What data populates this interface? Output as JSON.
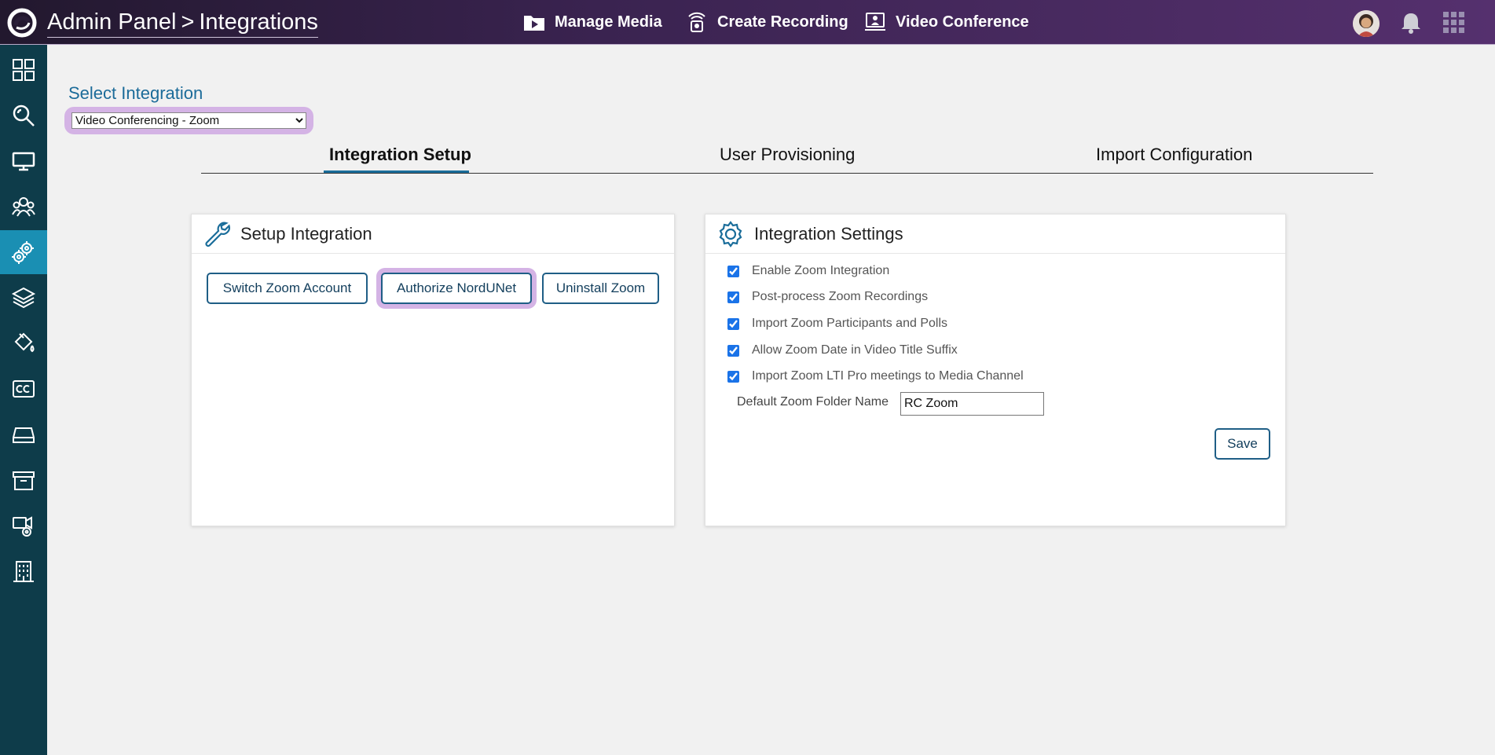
{
  "header": {
    "breadcrumb_root": "Admin Panel",
    "breadcrumb_sep": ">",
    "breadcrumb_current": "Integrations",
    "nav": [
      {
        "label": "Manage Media",
        "icon": "media-folder-icon"
      },
      {
        "label": "Create Recording",
        "icon": "recording-icon"
      },
      {
        "label": "Video Conference",
        "icon": "video-conference-icon"
      }
    ]
  },
  "sidebar": {
    "items": [
      {
        "icon": "dashboard-icon"
      },
      {
        "icon": "search-icon"
      },
      {
        "icon": "monitor-icon"
      },
      {
        "icon": "users-icon"
      },
      {
        "icon": "settings-gears-icon",
        "active": true
      },
      {
        "icon": "layers-icon"
      },
      {
        "icon": "paint-bucket-icon"
      },
      {
        "icon": "closed-caption-icon"
      },
      {
        "icon": "drive-icon"
      },
      {
        "icon": "archive-icon"
      },
      {
        "icon": "video-settings-icon"
      },
      {
        "icon": "building-icon"
      }
    ]
  },
  "select_integration": {
    "label": "Select Integration",
    "selected": "Video Conferencing - Zoom"
  },
  "tabs": [
    {
      "label": "Integration Setup",
      "active": true
    },
    {
      "label": "User Provisioning"
    },
    {
      "label": "Import Configuration"
    }
  ],
  "setup_card": {
    "title": "Setup Integration",
    "buttons": {
      "switch": "Switch Zoom Account",
      "authorize": "Authorize NordUNet",
      "uninstall": "Uninstall Zoom"
    }
  },
  "settings_card": {
    "title": "Integration Settings",
    "options": [
      {
        "label": "Enable Zoom Integration",
        "checked": true
      },
      {
        "label": "Post-process Zoom Recordings",
        "checked": true
      },
      {
        "label": "Import Zoom Participants and Polls",
        "checked": true
      },
      {
        "label": "Allow Zoom Date in Video Title Suffix",
        "checked": true
      },
      {
        "label": "Import Zoom LTI Pro meetings to Media Channel",
        "checked": true
      }
    ],
    "folder_label": "Default Zoom Folder Name",
    "folder_value": "RC Zoom",
    "save_label": "Save"
  },
  "colors": {
    "sidebar": "#0e3c4a",
    "sidebar_active": "#1a8fb3",
    "highlight": "#d4b3e5",
    "accent": "#1f5e86"
  }
}
